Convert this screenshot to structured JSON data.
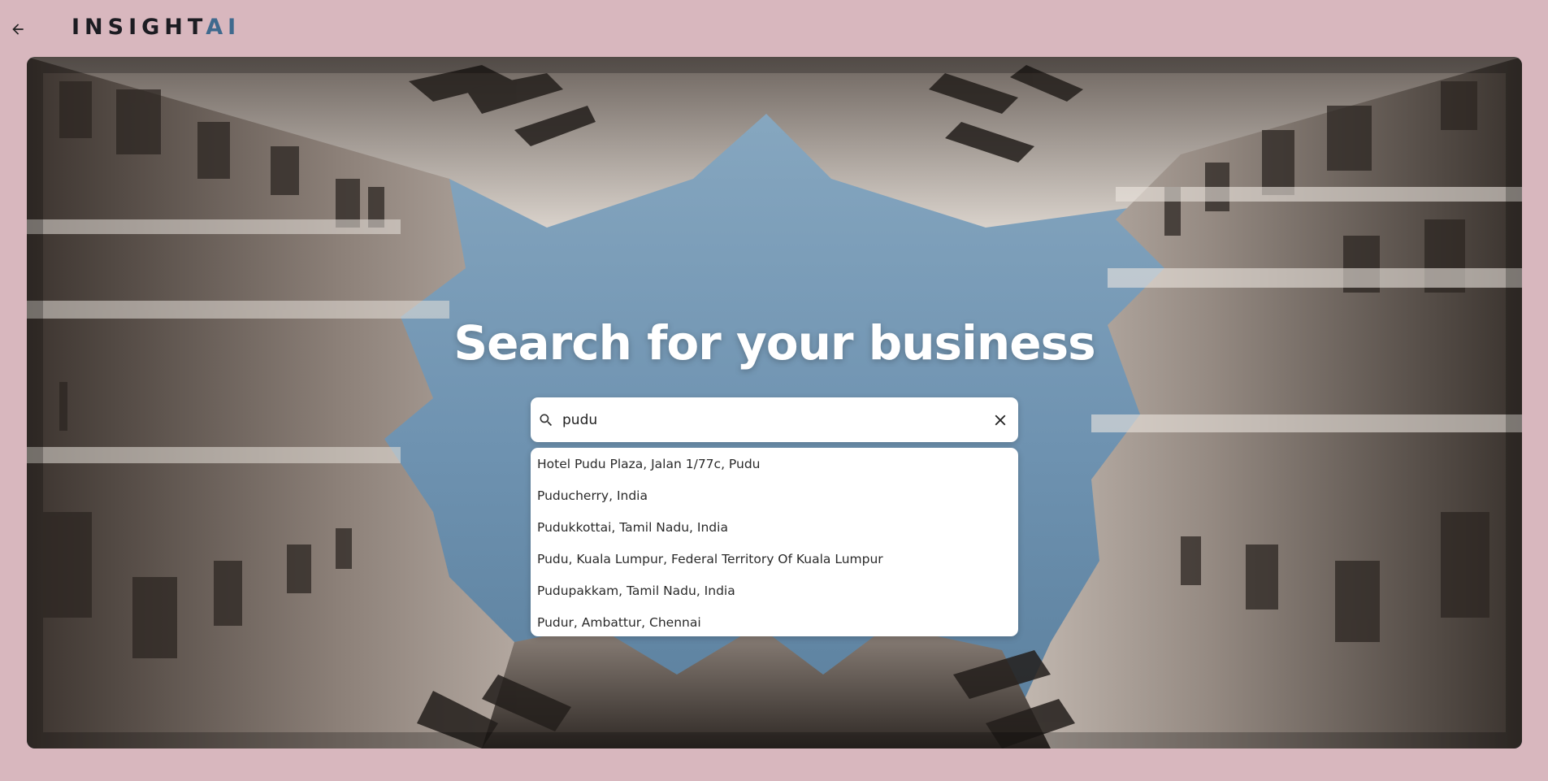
{
  "header": {
    "back_icon": "arrow-left-icon",
    "logo_main": "INSIGHT",
    "logo_accent": "AI"
  },
  "hero": {
    "headline": "Search for your business"
  },
  "search": {
    "icon": "search-icon",
    "value": "pudu",
    "clear_icon": "close-icon"
  },
  "suggestions": [
    {
      "label": "Hotel Pudu Plaza, Jalan 1/77c, Pudu"
    },
    {
      "label": "Puducherry, India"
    },
    {
      "label": "Pudukkottai, Tamil Nadu, India"
    },
    {
      "label": "Pudu, Kuala Lumpur, Federal Territory Of Kuala Lumpur"
    },
    {
      "label": "Pudupakkam, Tamil Nadu, India"
    },
    {
      "label": "Pudur, Ambattur, Chennai"
    }
  ],
  "colors": {
    "page_background": "#d8b7be",
    "logo_accent": "#3f6a8e",
    "sky": "#7fa2bf"
  }
}
